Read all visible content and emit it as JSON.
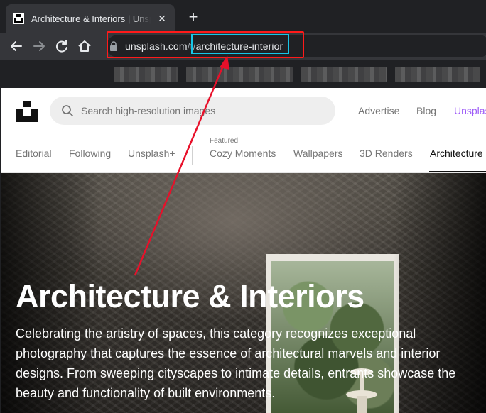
{
  "browser": {
    "tab": {
      "title": "Architecture & Interiors | Unsplash",
      "close_glyph": "✕"
    },
    "new_tab_glyph": "+",
    "address": {
      "host": "unsplash.com",
      "path_prefix": "/t/",
      "path_slug": "architecture-interior"
    }
  },
  "unsplash": {
    "search": {
      "placeholder": "Search high-resolution images"
    },
    "header_links": [
      "Advertise",
      "Blog",
      "Unsplash+"
    ],
    "brand_color": "#9e5cf7",
    "categories": {
      "featured_label": "Featured",
      "items": [
        "Editorial",
        "Following",
        "Unsplash+",
        "Cozy Moments",
        "Wallpapers",
        "3D Renders",
        "Architecture & Interiors"
      ],
      "active": "Architecture & Interiors"
    },
    "hero": {
      "title": "Architecture & Interiors",
      "description": "Celebrating the artistry of spaces, this category recognizes exceptional photography that captures the essence of architectural marvels and interior designs. From sweeping cityscapes to intimate details, entrants showcase the beauty and functionality of built environments."
    }
  },
  "annotation": {
    "box_color": "#ff1a1a",
    "highlight_color": "#16c6e8",
    "arrow_color": "#e8102a"
  },
  "icons": [
    "unsplash-favicon-icon",
    "back-arrow-icon",
    "forward-arrow-icon",
    "reload-icon",
    "home-icon",
    "lock-icon",
    "search-icon",
    "unsplash-logo-icon"
  ]
}
